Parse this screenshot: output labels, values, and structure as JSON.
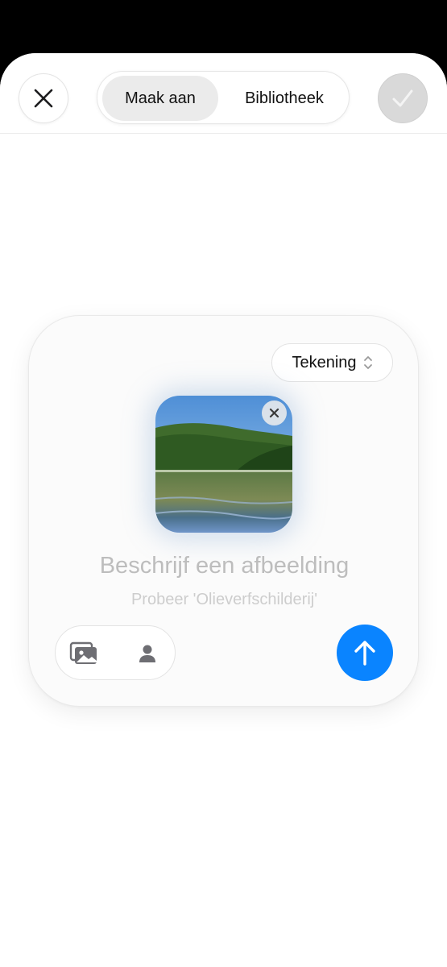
{
  "header": {
    "tabs": [
      {
        "label": "Maak aan",
        "active": true
      },
      {
        "label": "Bibliotheek",
        "active": false
      }
    ],
    "close_icon": "close-icon",
    "done_icon": "checkmark-icon"
  },
  "composer": {
    "style_picker": {
      "label": "Tekening",
      "icon": "chevron-up-down-icon"
    },
    "prompt_placeholder": "Beschrijf een afbeelding",
    "hint": "Probeer 'Olieverfschilderij'",
    "tools": [
      "photo-library-icon",
      "person-icon"
    ],
    "send_icon": "arrow-up-icon"
  },
  "colors": {
    "accent": "#0a84ff",
    "background": "#ffffff",
    "top_bar": "#000000"
  }
}
